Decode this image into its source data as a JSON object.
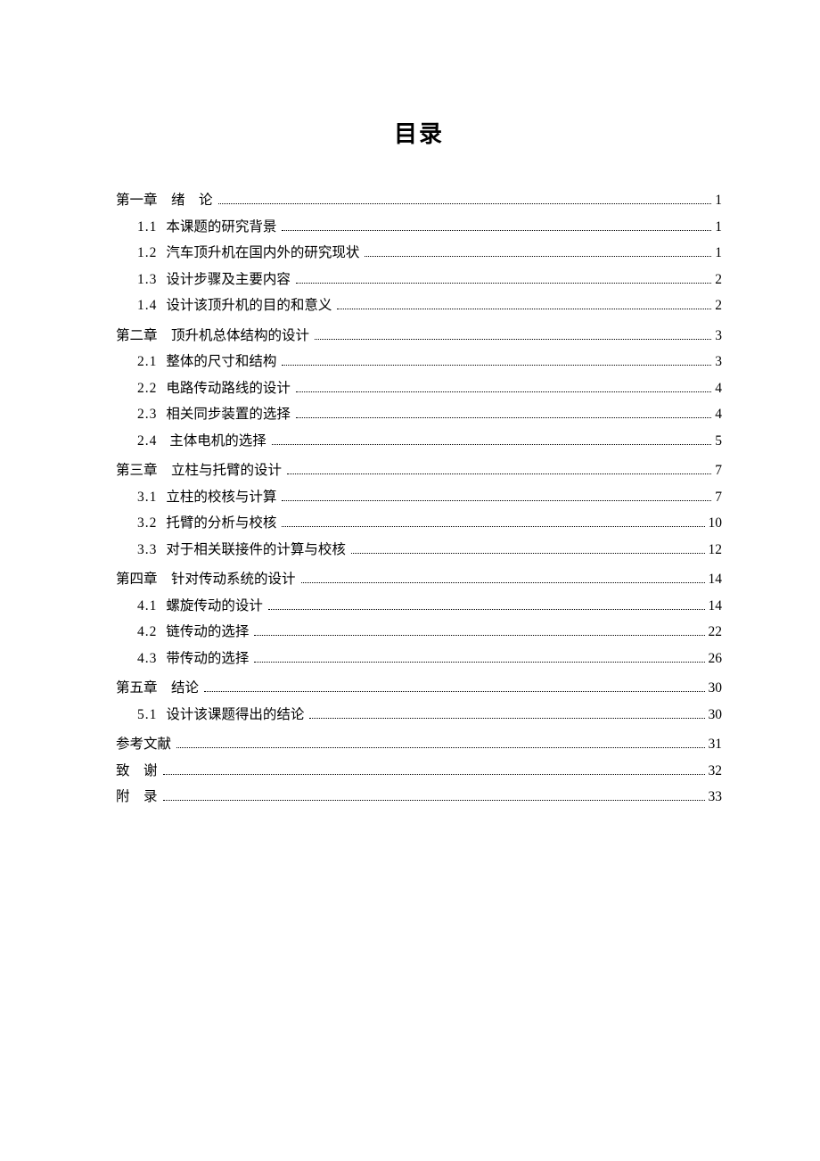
{
  "title": "目录",
  "entries": [
    {
      "type": "chapter",
      "label": "第一章 绪 论",
      "page": "1"
    },
    {
      "type": "sub",
      "num": "1.1",
      "label": "本课题的研究背景",
      "page": "1"
    },
    {
      "type": "sub",
      "num": "1.2",
      "label": "汽车顶升机在国内外的研究现状",
      "page": "1"
    },
    {
      "type": "sub",
      "num": "1.3",
      "label": "设计步骤及主要内容",
      "page": "2"
    },
    {
      "type": "sub",
      "num": "1.4",
      "label": "设计该顶升机的目的和意义",
      "page": "2"
    },
    {
      "type": "chapter",
      "label": "第二章 顶升机总体结构的设计",
      "page": "3"
    },
    {
      "type": "sub",
      "num": "2.1",
      "label": "整体的尺寸和结构",
      "page": "3"
    },
    {
      "type": "sub",
      "num": "2.2",
      "label": "电路传动路线的设计",
      "page": "4"
    },
    {
      "type": "sub",
      "num": "2.3",
      "label": "相关同步装置的选择",
      "page": "4"
    },
    {
      "type": "sub",
      "num": "2.4",
      "label": " 主体电机的选择",
      "page": "5"
    },
    {
      "type": "chapter",
      "label": "第三章 立柱与托臂的设计",
      "page": "7"
    },
    {
      "type": "sub",
      "num": "3.1",
      "label": "立柱的校核与计算",
      "page": "7"
    },
    {
      "type": "sub",
      "num": "3.2",
      "label": "托臂的分析与校核",
      "page": "10"
    },
    {
      "type": "sub",
      "num": "3.3",
      "label": "对于相关联接件的计算与校核",
      "page": "12"
    },
    {
      "type": "chapter",
      "label": "第四章 针对传动系统的设计",
      "page": "14"
    },
    {
      "type": "sub",
      "num": "4.1",
      "label": "螺旋传动的设计",
      "page": "14"
    },
    {
      "type": "sub",
      "num": "4.2",
      "label": "链传动的选择",
      "page": "22"
    },
    {
      "type": "sub",
      "num": "4.3",
      "label": "带传动的选择",
      "page": "26"
    },
    {
      "type": "chapter",
      "label": "第五章 结论",
      "page": "30"
    },
    {
      "type": "sub",
      "num": "5.1",
      "label": "设计该课题得出的结论",
      "page": "30"
    },
    {
      "type": "chapter",
      "label": "参考文献",
      "page": "31"
    },
    {
      "type": "chapter",
      "label": "致 谢",
      "page": "32"
    },
    {
      "type": "chapter",
      "label": "附 录",
      "page": "33"
    }
  ]
}
